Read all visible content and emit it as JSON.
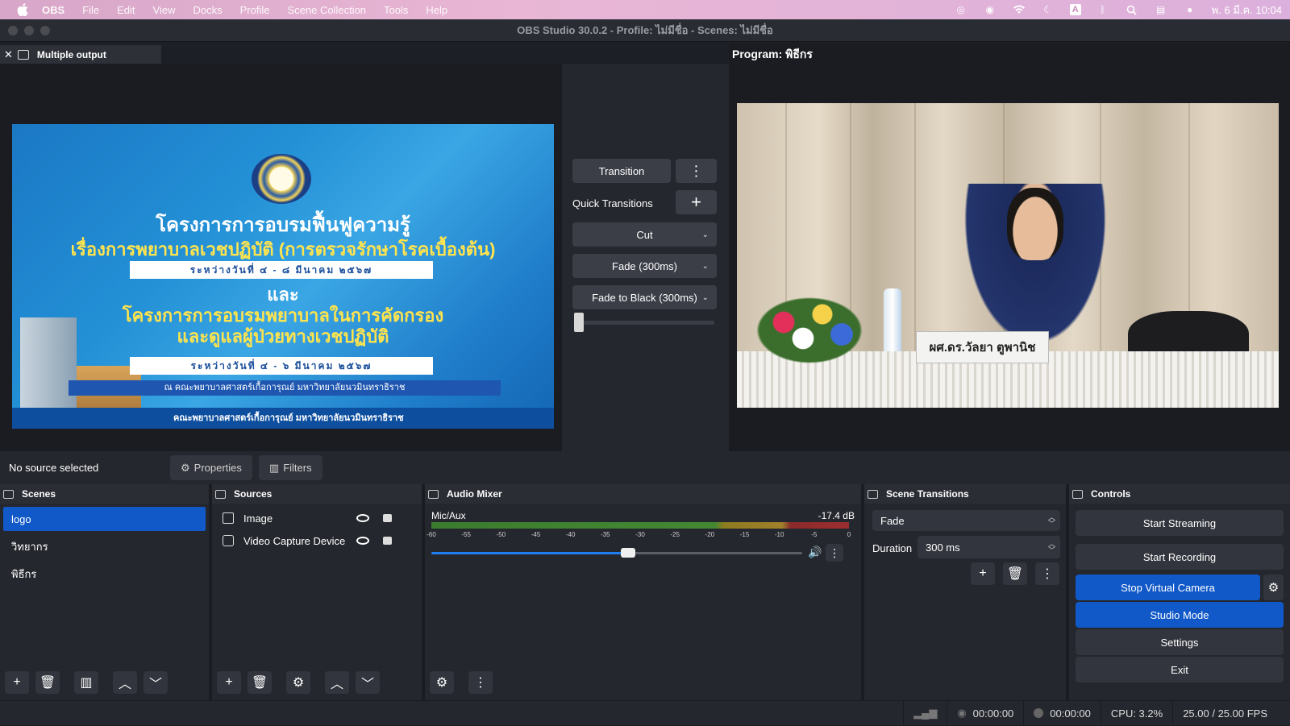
{
  "menubar": {
    "app": "OBS",
    "items": [
      "File",
      "Edit",
      "View",
      "Docks",
      "Profile",
      "Scene Collection",
      "Tools",
      "Help"
    ],
    "clock": "พ. 6 มี.ค.  10:04"
  },
  "window": {
    "title": "OBS Studio 30.0.2 - Profile: ไม่มีชื่อ - Scenes: ไม่มีชื่อ"
  },
  "multiview_tab": "Multiple output",
  "preview_slide": {
    "line1": "โครงการการอบรมฟื้นฟูความรู้",
    "line2": "เรื่องการพยาบาลเวชปฏิบัติ (การตรวจรักษาโรคเบื้องต้น)",
    "date1": "ระหว่างวันที่ ๔ - ๘ มีนาคม ๒๕๖๗",
    "and": "และ",
    "line3": "โครงการการอบรมพยาบาลในการคัดกรอง",
    "line4": "และดูแลผู้ป่วยทางเวชปฏิบัติ",
    "date2": "ระหว่างวันที่ ๔ - ๖ มีนาคม ๒๕๖๗",
    "venue": "ณ คณะพยาบาลศาสตร์เกื้อการุณย์ มหาวิทยาลัยนวมินทราธิราช",
    "footer": "คณะพยาบาลศาสตร์เกื้อการุณย์  มหาวิทยาลัยนวมินทราธิราช"
  },
  "transitions_panel": {
    "transition_label": "Transition",
    "quick_label": "Quick Transitions",
    "cut": "Cut",
    "fade": "Fade (300ms)",
    "fade_black": "Fade to Black (300ms)"
  },
  "program": {
    "title": "Program: พิธีกร",
    "nameplate": "ผศ.ดร.วัลยา ตูพานิช"
  },
  "source_bar": {
    "status": "No source selected",
    "properties": "Properties",
    "filters": "Filters"
  },
  "scenes": {
    "title": "Scenes",
    "items": [
      {
        "label": "logo",
        "active": true
      },
      {
        "label": "วิทยากร",
        "active": false
      },
      {
        "label": "พิธีกร",
        "active": false
      }
    ]
  },
  "sources": {
    "title": "Sources",
    "items": [
      {
        "label": "Image",
        "icon": "image-icon"
      },
      {
        "label": "Video Capture Device",
        "icon": "camera-icon"
      }
    ]
  },
  "audio_mixer": {
    "title": "Audio Mixer",
    "channel": "Mic/Aux",
    "level": "-17.4 dB",
    "ticks": [
      "-60",
      "-55",
      "-50",
      "-45",
      "-40",
      "-35",
      "-30",
      "-25",
      "-20",
      "-15",
      "-10",
      "-5",
      "0"
    ],
    "volume_fraction": 0.53
  },
  "scene_transitions": {
    "title": "Scene Transitions",
    "selected": "Fade",
    "duration_label": "Duration",
    "duration_value": "300 ms"
  },
  "controls": {
    "title": "Controls",
    "start_streaming": "Start Streaming",
    "start_recording": "Start Recording",
    "stop_virtual_camera": "Stop Virtual Camera",
    "studio_mode": "Studio Mode",
    "settings": "Settings",
    "exit": "Exit"
  },
  "statusbar": {
    "stream_time": "00:00:00",
    "record_time": "00:00:00",
    "cpu": "CPU: 3.2%",
    "fps": "25.00 / 25.00 FPS"
  },
  "colors": {
    "accent": "#1159c8",
    "panel": "#25272e",
    "background": "#1d1f26"
  }
}
